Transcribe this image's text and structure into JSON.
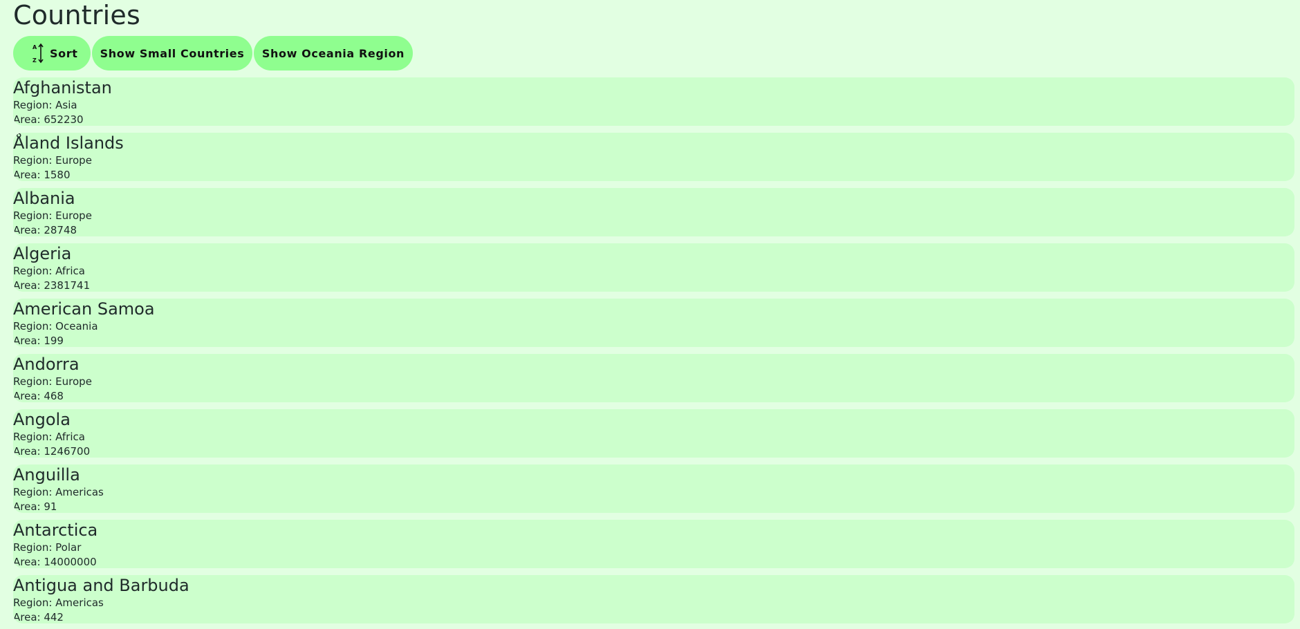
{
  "page": {
    "title": "Countries"
  },
  "toolbar": {
    "sort_label": "Sort",
    "sort_icon": "sort-alpha-icon",
    "small_label": "Show Small Countries",
    "oceania_label": "Show Oceania Region"
  },
  "colors": {
    "background": "#e2ffe2",
    "button": "#8ffe8f",
    "card": "#ccffcc"
  },
  "countries": [
    {
      "name": "Afghanistan",
      "region": "Region: Asia",
      "area": "Area: 652230"
    },
    {
      "name": "Åland Islands",
      "region": "Region: Europe",
      "area": "Area: 1580"
    },
    {
      "name": "Albania",
      "region": "Region: Europe",
      "area": "Area: 28748"
    },
    {
      "name": "Algeria",
      "region": "Region: Africa",
      "area": "Area: 2381741"
    },
    {
      "name": "American Samoa",
      "region": "Region: Oceania",
      "area": "Area: 199"
    },
    {
      "name": "Andorra",
      "region": "Region: Europe",
      "area": "Area: 468"
    },
    {
      "name": "Angola",
      "region": "Region: Africa",
      "area": "Area: 1246700"
    },
    {
      "name": "Anguilla",
      "region": "Region: Americas",
      "area": "Area: 91"
    },
    {
      "name": "Antarctica",
      "region": "Region: Polar",
      "area": "Area: 14000000"
    },
    {
      "name": "Antigua and Barbuda",
      "region": "Region: Americas",
      "area": "Area: 442"
    }
  ]
}
